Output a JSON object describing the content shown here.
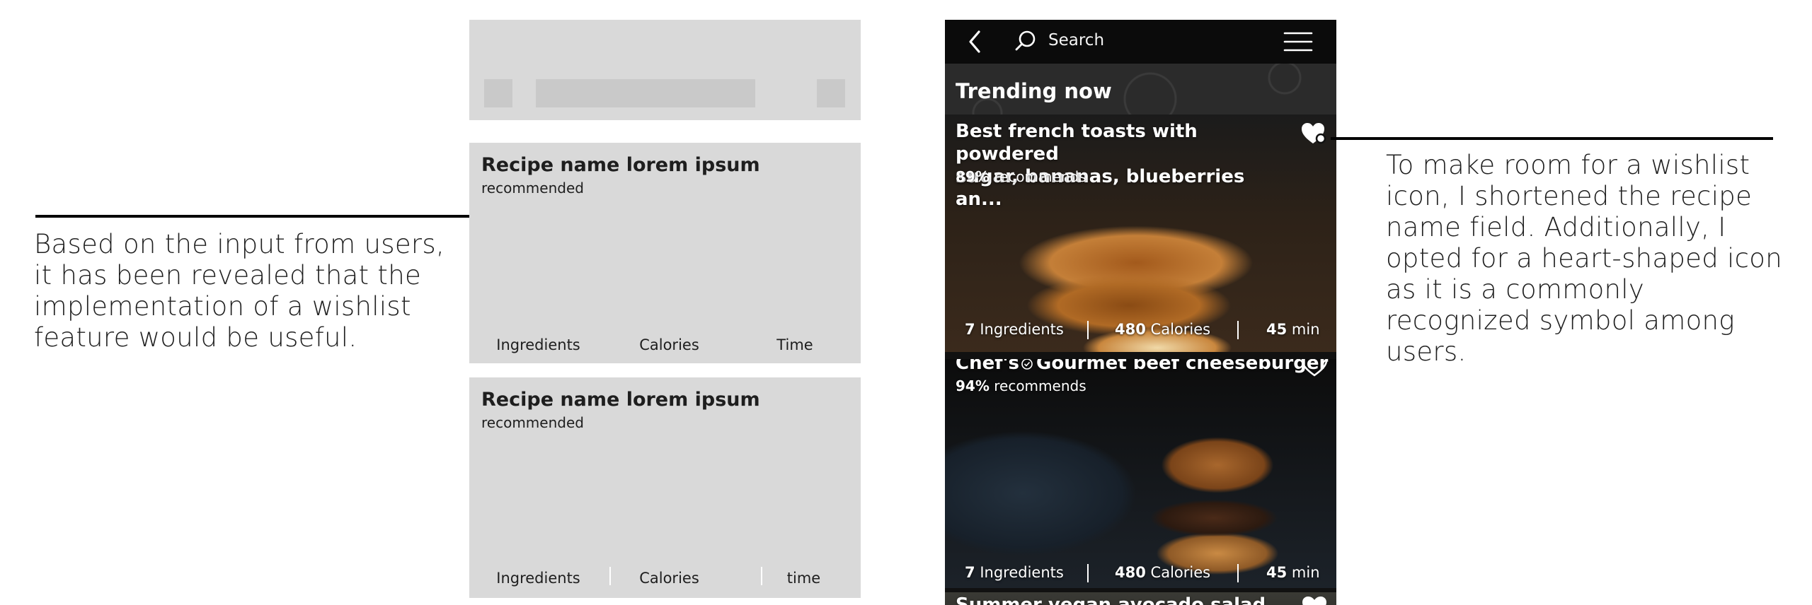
{
  "annotations": {
    "left": "Based on the input from users,\nit has been revealed that the\nimplementation of a wishlist\nfeature would be useful.",
    "right": "To make room for a wishlist\nicon, I shortened the recipe\nname field. Additionally, I\nopted for a heart-shaped icon\nas it is a commonly\nrecognized symbol among\nusers."
  },
  "wireframe": {
    "cards": [
      {
        "title": "Recipe name lorem ipsum",
        "subtitle": "recommended",
        "stats": [
          "Ingredients",
          "Calories",
          "Time"
        ]
      },
      {
        "title": "Recipe name lorem ipsum",
        "subtitle": "recommended",
        "stats": [
          "Ingredients",
          "Calories",
          "time"
        ]
      }
    ]
  },
  "app": {
    "header": {
      "search_label": "Search",
      "back_icon": "chevron-left-icon",
      "search_icon": "search-icon",
      "menu_icon": "hamburger-menu-icon"
    },
    "section_title": "Trending now",
    "cards": [
      {
        "title_line1": "Best french toasts with powdered",
        "title_line2": "sugar, bananas, blueberries an...",
        "rec_pct": "89%",
        "rec_label": "recommends",
        "ingredients_num": "7",
        "ingredients_label": "Ingredients",
        "calories_num": "480",
        "calories_label": "Calories",
        "time_num": "45",
        "time_label": "min",
        "wishlisted": true
      },
      {
        "title_prefix": "Chef's",
        "title_rest": "Gourmet beef cheeseburger",
        "rec_pct": "94%",
        "rec_label": "recommends",
        "ingredients_num": "7",
        "ingredients_label": "Ingredients",
        "calories_num": "480",
        "calories_label": "Calories",
        "time_num": "45",
        "time_label": "min",
        "wishlisted": false
      },
      {
        "title": "Summer vegan avocado salad",
        "wishlisted": true
      }
    ]
  },
  "colors": {
    "topbar": "#0b0b0b",
    "wireframe_bg": "#d9d9d9",
    "wireframe_block": "#c9c9c9",
    "text_dark": "#1a1a1a"
  }
}
